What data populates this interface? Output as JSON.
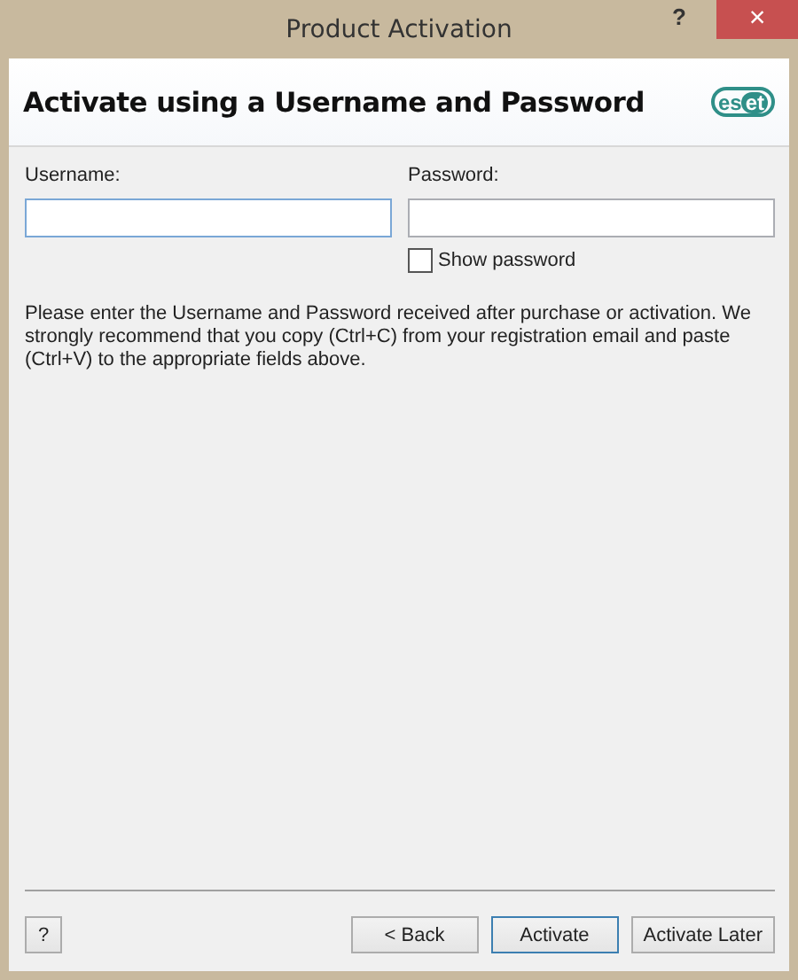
{
  "window": {
    "title": "Product Activation",
    "help_button": "?",
    "close_button": "×"
  },
  "header": {
    "title": "Activate using a Username and Password",
    "logo": "eset"
  },
  "fields": [
    {
      "label": "Username:",
      "focused": true
    },
    {
      "label": "Password:",
      "focused": false
    }
  ],
  "show_password": {
    "label": "Show password",
    "checked": false
  },
  "instructions": "Please enter the Username and Password received after purchase or activation. We strongly recommend that you copy (Ctrl+C) from your registration email and paste (Ctrl+V) to the appropriate fields above.",
  "footer": {
    "help": "?",
    "buttons": [
      {
        "label": "< Back",
        "default": false
      },
      {
        "label": "Activate",
        "default": true
      },
      {
        "label": "Activate Later",
        "default": false
      }
    ]
  }
}
